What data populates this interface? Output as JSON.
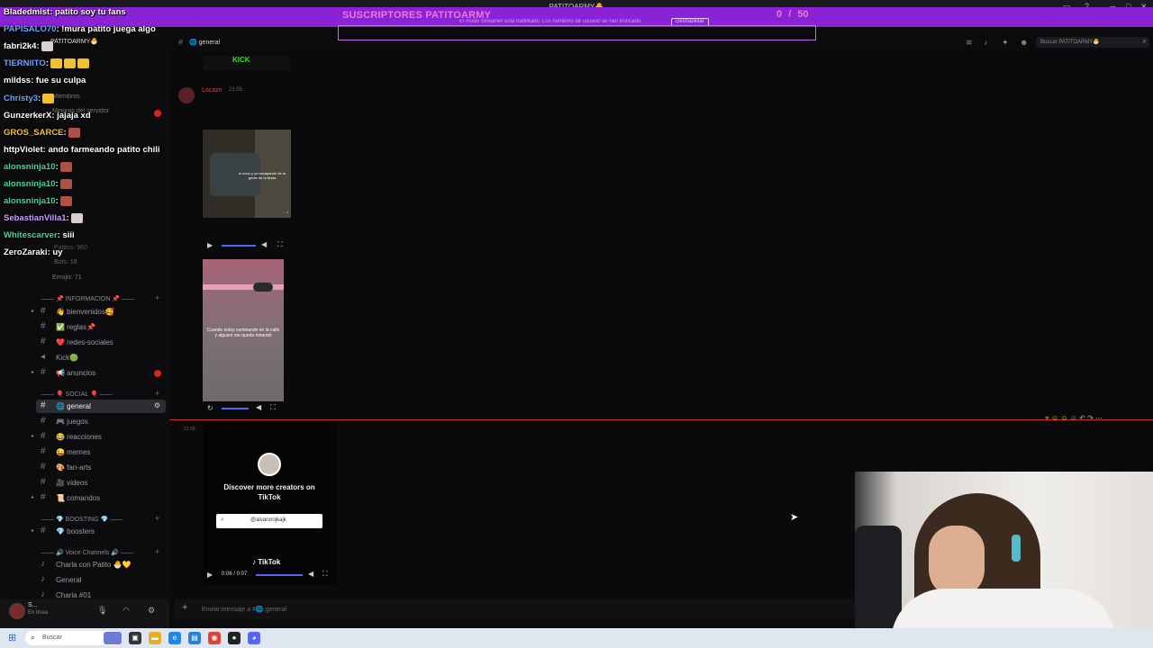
{
  "window": {
    "title": "PATITOARMY🐣"
  },
  "subscriber_goal": {
    "label": "SUSCRIPTORES PATITOARMY",
    "count": "0",
    "separator": "/",
    "goal": "50"
  },
  "notice": {
    "text": "El modo Streamer está habilitado. Los nombres de usuario se han truncado.",
    "button": "Deshabilitar"
  },
  "server": {
    "name": "PATITOARMY🐣"
  },
  "sidebar": {
    "ghost_items": [
      "Miembros",
      "Mejoras del servidor",
      "Patitos: 960",
      "Bots: 18",
      "Emojis: 71"
    ],
    "categories": [
      {
        "label": "—— 📌 INFORMACION 📌 ——"
      },
      {
        "label": "—— 🎈 SOCIAL 🎈 ——"
      },
      {
        "label": "—— 💎 BOOSTING 💎 ——"
      },
      {
        "label": "—— 🔊 Voice Channels 🔊 ——"
      }
    ],
    "channels": [
      {
        "label": "👋 bienvenidos🥰"
      },
      {
        "label": "✅ reglas📌"
      },
      {
        "label": "❤️ redes-sociales"
      },
      {
        "label": "Kick🟢"
      },
      {
        "label": "📢 anuncios"
      },
      {
        "label": "🌐 general"
      },
      {
        "label": "🎮 juegos"
      },
      {
        "label": "😂 reacciones"
      },
      {
        "label": "😜 memes"
      },
      {
        "label": "🎨 fan-arts"
      },
      {
        "label": "🎥 videos"
      },
      {
        "label": "📜 comandos"
      },
      {
        "label": "💎 boosters"
      },
      {
        "label": "Charla con Patito 🐣💛"
      },
      {
        "label": "General"
      },
      {
        "label": "Charla #01"
      }
    ]
  },
  "user": {
    "name": "S...",
    "status": "En línea"
  },
  "channel_header": {
    "name": "🌐 general"
  },
  "search": {
    "placeholder": "Buscar PATITOARMY🐣"
  },
  "messages": {
    "author": "Locazn",
    "time": "21:55",
    "video1_caption": "el sodo y yo escapando de la gente de la fiesta",
    "video2_caption": "Cuando estoy caminando en la calle y alguien me queda mirando",
    "time2": "21:58",
    "kick_label": "KICK"
  },
  "tiktok": {
    "title": "Discover more creators on TikTok",
    "input_value": "@alvarorojkajk",
    "logo": "♪ TikTok",
    "time": "0:06 / 0:07"
  },
  "composer": {
    "placeholder": "Enviar mensaje a #🌐 general"
  },
  "chat": [
    {
      "user": "Bladedmist",
      "color": "#ffffff",
      "text": ": patito soy tu fans",
      "emotes": 0
    },
    {
      "user": "PAPISALO70",
      "color": "#6aa6ff",
      "text": ": !mura patito juega algo",
      "emotes": 0
    },
    {
      "user": "fabri2k4",
      "color": "#ffffff",
      "text": ":",
      "emotes": 1
    },
    {
      "user": "TIERNIITO",
      "color": "#6aa6ff",
      "text": ":",
      "emotes": 3
    },
    {
      "user": "mildss",
      "color": "#ffffff",
      "text": ": fue su culpa",
      "emotes": 0
    },
    {
      "user": "Christy3",
      "color": "#6aa6ff",
      "text": ":",
      "emotes": 1
    },
    {
      "user": "GunzerkerX",
      "color": "#ffffff",
      "text": ": jajaja xd",
      "emotes": 0
    },
    {
      "user": "GROS_SARCE",
      "color": "#f0c040",
      "text": ":",
      "emotes": 1
    },
    {
      "user": "httpViolet",
      "color": "#ffffff",
      "text": ": ando farmeando patito chili",
      "emotes": 0
    },
    {
      "user": "alonsninja10",
      "color": "#3ed8a0",
      "text": ":",
      "emotes": 1
    },
    {
      "user": "alonsninja10",
      "color": "#3ed8a0",
      "text": ":",
      "emotes": 1
    },
    {
      "user": "alonsninja10",
      "color": "#3ed8a0",
      "text": ":",
      "emotes": 1
    },
    {
      "user": "SebastianVilla1",
      "color": "#c8a0ff",
      "text": ":",
      "emotes": 1
    },
    {
      "user": "Whitescarver",
      "color": "#3ed8a0",
      "text": ": siii",
      "emotes": 0
    },
    {
      "user": "ZeroZaraki",
      "color": "#ffffff",
      "text": ": uy",
      "emotes": 0
    }
  ],
  "taskbar": {
    "search_label": "Buscar"
  }
}
